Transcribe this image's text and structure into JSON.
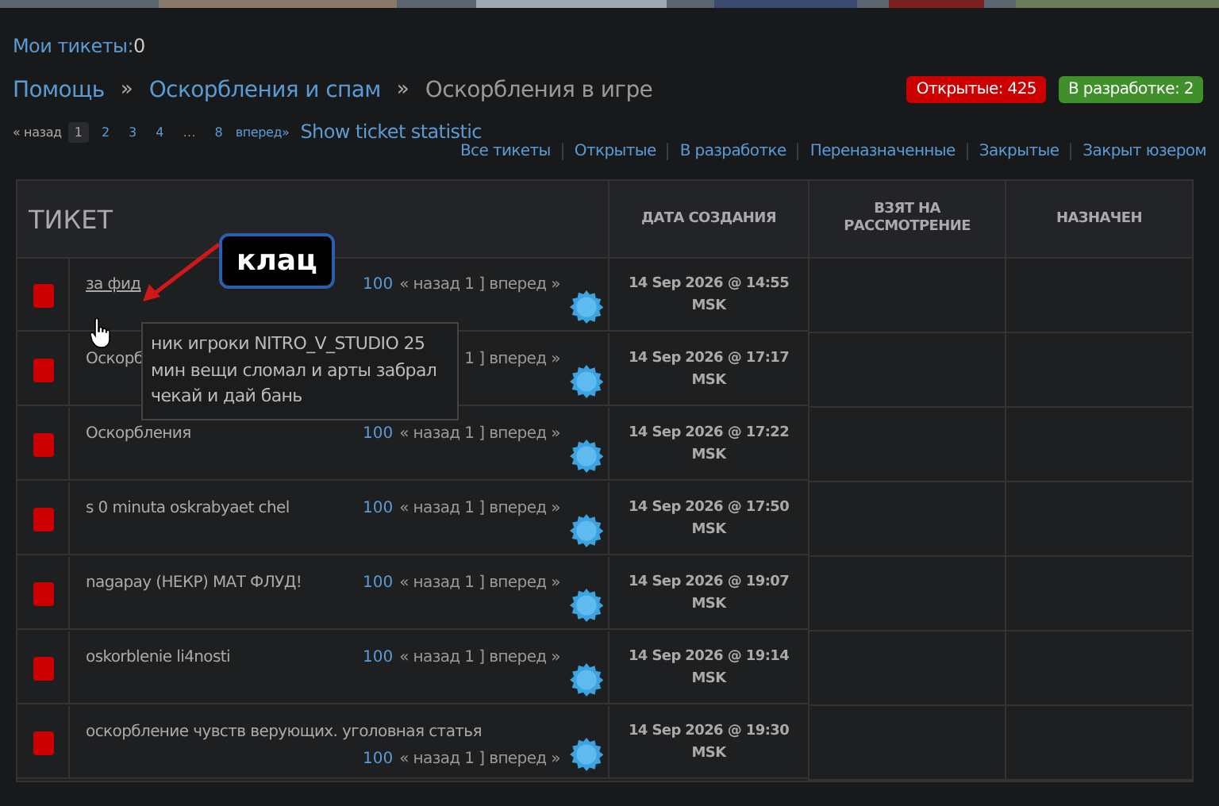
{
  "my_tickets": {
    "label": "Мои тикеты:",
    "count": "0"
  },
  "breadcrumbs": [
    {
      "label": "Помощь",
      "link": true
    },
    {
      "label": "Оскорбления и спам",
      "link": true
    },
    {
      "label": "Оскорбления в игре",
      "link": false
    }
  ],
  "separator": "»",
  "counters": [
    {
      "label": "Открытые: 425",
      "color": "#cc0000"
    },
    {
      "label": "В разработке: 2",
      "color": "#3f8f2a"
    }
  ],
  "pagination": {
    "prev": "« назад",
    "pages": [
      {
        "label": "1",
        "selected": true
      },
      {
        "label": "2",
        "selected": false
      },
      {
        "label": "3",
        "selected": false
      },
      {
        "label": "4",
        "selected": false
      },
      {
        "label": "…",
        "selected": false,
        "kind": "gap"
      },
      {
        "label": "8",
        "selected": false
      }
    ],
    "next": "вперед»",
    "stats_link": "Show ticket statistic"
  },
  "filters": [
    "Все тикеты",
    "Открытые",
    "В разработке",
    "Переназначенные",
    "Закрытые",
    "Закрыт юзером"
  ],
  "table": {
    "columns": [
      "ТИКЕТ",
      "ДАТА СОЗДАНИЯ",
      "ВЗЯТ НА РАССМОТРЕНИЕ",
      "НАЗНАЧЕН"
    ],
    "rows": [
      {
        "open": true,
        "title": "за фид",
        "hovered": true,
        "count": "100",
        "nav": "« назад 1 ] вперед »",
        "date": "14 Sep 2026 @ 14:55",
        "tz": "MSK"
      },
      {
        "open": true,
        "title": "Оскорб",
        "hovered": false,
        "nav": "1 ] вперед »",
        "date": "14 Sep 2026 @ 17:17",
        "tz": "MSK"
      },
      {
        "open": true,
        "title": "Оскорбления",
        "hovered": false,
        "count": "100",
        "nav": "« назад 1 ] вперед »",
        "date": "14 Sep 2026 @ 17:22",
        "tz": "MSK"
      },
      {
        "open": true,
        "title": "s 0 minuta oskrabyaet chel",
        "hovered": false,
        "count": "100",
        "nav": "« назад 1 ] вперед »",
        "date": "14 Sep 2026 @ 17:50",
        "tz": "MSK"
      },
      {
        "open": true,
        "title": "nagapay (НЕКР) МАТ ФЛУД!",
        "hovered": false,
        "count": "100",
        "nav": "« назад 1 ] вперед »",
        "date": "14 Sep 2026 @ 19:07",
        "tz": "MSK"
      },
      {
        "open": true,
        "title": "oskorblenie li4nosti",
        "hovered": false,
        "count": "100",
        "nav": "« назад 1 ] вперед »",
        "date": "14 Sep 2026 @ 19:14",
        "tz": "MSK"
      },
      {
        "open": true,
        "title": "оскорбление чувств верующих. уголовная статья",
        "hovered": false,
        "count": "100",
        "nav": "« назад 1 ] вперед »",
        "date": "14 Sep 2026 @ 19:30",
        "tz": "MSK"
      }
    ]
  },
  "tooltip": "ник игроки NITRO_V_STUDIO 25 мин вещи сломал и арты забрал чекай и дай бань",
  "annotation": "клац"
}
